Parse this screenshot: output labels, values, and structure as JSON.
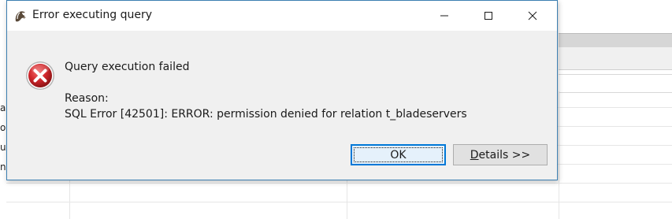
{
  "dialog": {
    "title": "Error executing query",
    "heading": "Query execution failed",
    "reason_label": "Reason:",
    "reason_text": "SQL Error [42501]: ERROR: permission denied for relation t_bladeservers",
    "buttons": {
      "ok_label": "OK",
      "details_mnemonic": "D",
      "details_rest": "etails >>"
    },
    "window_controls": [
      "minimize-icon",
      "maximize-icon",
      "close-icon"
    ],
    "icons": {
      "app": "dbeaver-beaver-icon",
      "message": "error-icon"
    }
  },
  "background": {
    "cell_fragments": [
      "a",
      "o",
      "u",
      "n"
    ]
  },
  "colors": {
    "error_red": "#d1262b",
    "focus_blue": "#0078d7",
    "dialog_bg": "#f0f0f0",
    "dialog_border": "#3c7fb1"
  }
}
